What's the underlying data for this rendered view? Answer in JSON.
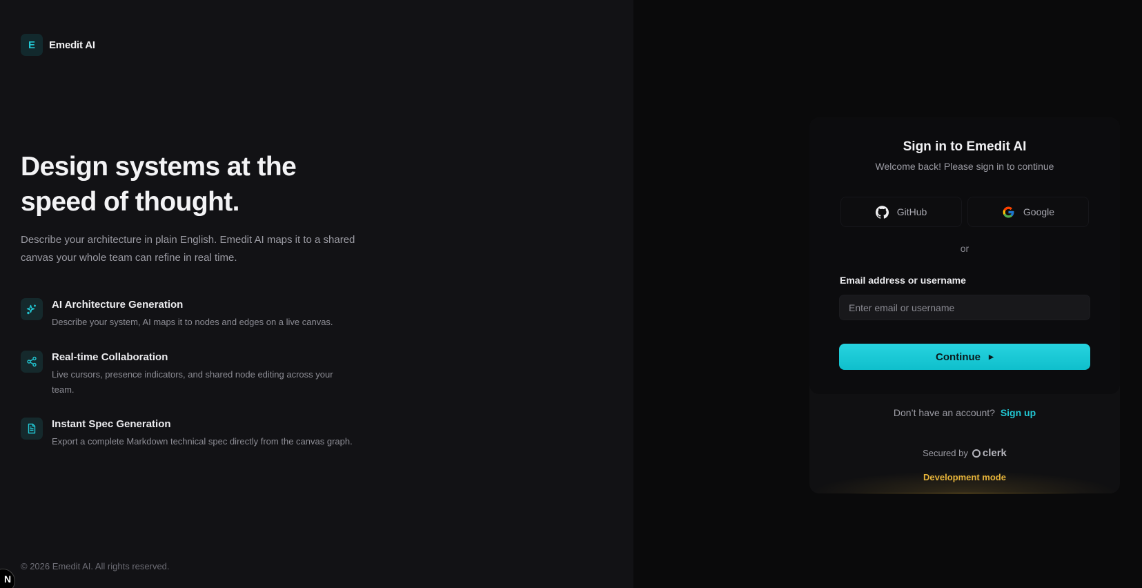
{
  "brand": {
    "mark": "E",
    "name": "Emedit AI"
  },
  "hero": {
    "headline_line1": "Design systems at the",
    "headline_line2": "speed of thought.",
    "lede": "Describe your architecture in plain English. Emedit AI maps it to a shared canvas your whole team can refine in real time."
  },
  "features": [
    {
      "icon": "sparkles-icon",
      "title": "AI Architecture Generation",
      "desc": "Describe your system, AI maps it to nodes and edges on a live canvas."
    },
    {
      "icon": "share-nodes-icon",
      "title": "Real-time Collaboration",
      "desc": "Live cursors, presence indicators, and shared node editing across your team."
    },
    {
      "icon": "document-icon",
      "title": "Instant Spec Generation",
      "desc": "Export a complete Markdown technical spec directly from the canvas graph."
    }
  ],
  "footer": {
    "copyright": "© 2026 Emedit AI. All rights reserved."
  },
  "dev_badge": {
    "label": "N"
  },
  "signin": {
    "title": "Sign in to Emedit AI",
    "subtitle": "Welcome back! Please sign in to continue",
    "github_label": "GitHub",
    "google_label": "Google",
    "divider": "or",
    "email_label": "Email address or username",
    "email_placeholder": "Enter email or username",
    "email_value": "",
    "continue_label": "Continue",
    "signup_prompt": "Don’t have an account?",
    "signup_link": "Sign up",
    "secured_by": "Secured by",
    "clerk_label": "clerk",
    "dev_mode": "Development mode"
  },
  "colors": {
    "accent": "#22c7d3",
    "warning": "#e5b33a",
    "left_bg": "#121215",
    "right_bg": "#0a0a0b"
  }
}
